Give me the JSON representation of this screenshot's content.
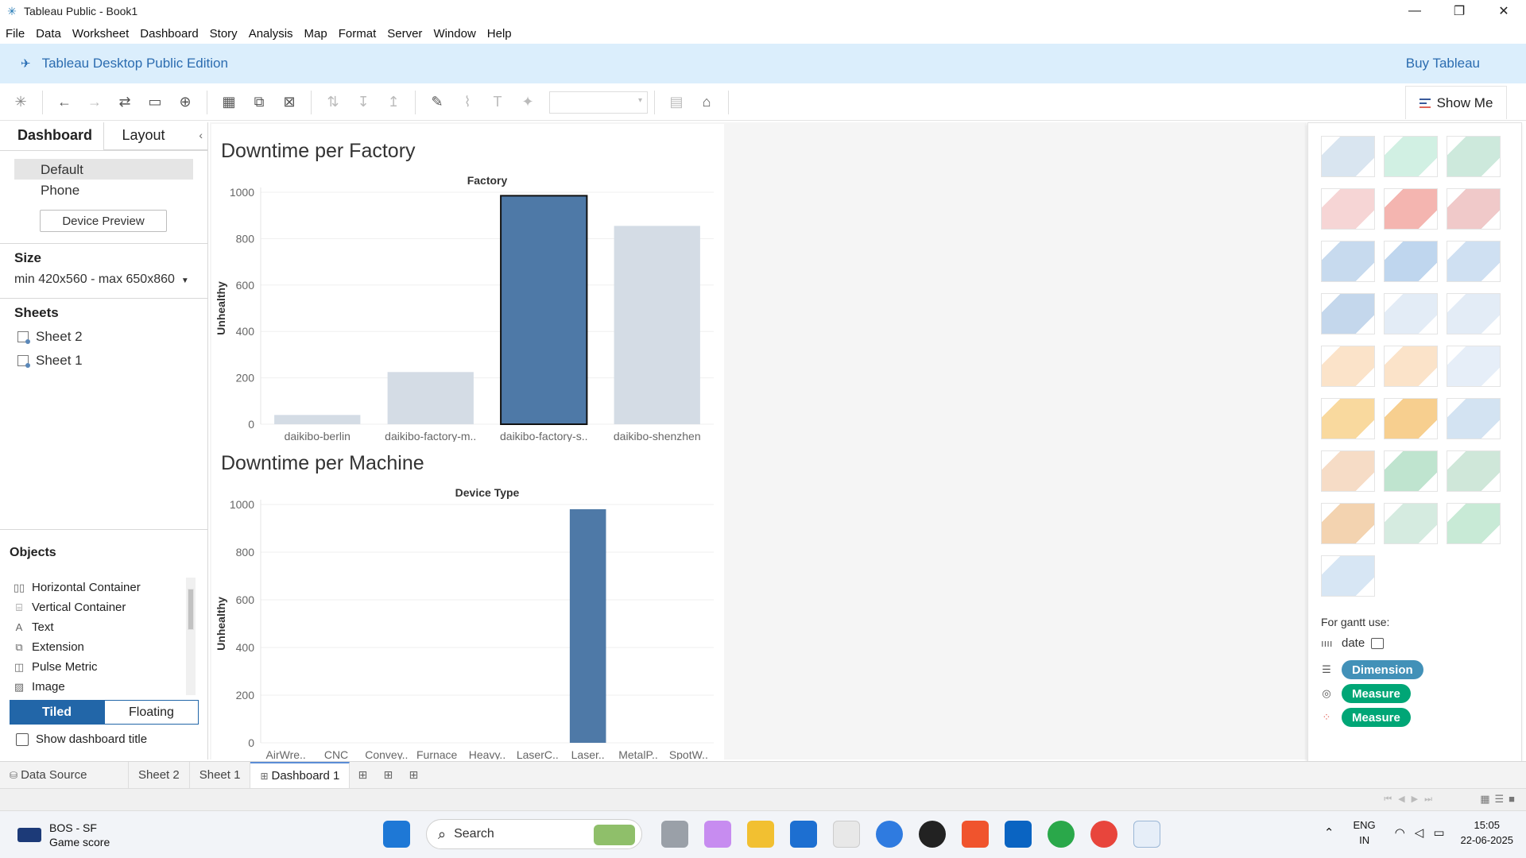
{
  "window": {
    "title": "Tableau Public - Book1",
    "controls": [
      "—",
      "❐",
      "✕"
    ]
  },
  "menu": [
    "File",
    "Data",
    "Worksheet",
    "Dashboard",
    "Story",
    "Analysis",
    "Map",
    "Format",
    "Server",
    "Window",
    "Help"
  ],
  "banner": {
    "edition": "Tableau Desktop Public Edition",
    "buy": "Buy Tableau"
  },
  "toolbar": {
    "show_me": "Show Me"
  },
  "left_panel": {
    "tabs": [
      "Dashboard",
      "Layout"
    ],
    "devices": [
      "Default",
      "Phone"
    ],
    "device_preview": "Device Preview",
    "size_heading": "Size",
    "size_value": "min 420x560 - max 650x860",
    "sheets_heading": "Sheets",
    "sheets": [
      "Sheet 2",
      "Sheet 1"
    ],
    "objects_heading": "Objects",
    "objects": [
      "Horizontal Container",
      "Vertical Container",
      "Text",
      "Extension",
      "Pulse Metric",
      "Image"
    ],
    "tiled": "Tiled",
    "floating": "Floating",
    "show_title": "Show dashboard title"
  },
  "chart_data": [
    {
      "type": "bar",
      "title": "Downtime per Factory",
      "xlabel": "Factory",
      "ylabel": "Unhealthy",
      "categories": [
        "daikibo-berlin",
        "daikibo-factory-m..",
        "daikibo-factory-s..",
        "daikibo-shenzhen"
      ],
      "values": [
        40,
        225,
        985,
        855
      ],
      "highlighted": "daikibo-factory-s..",
      "ylim": [
        0,
        1000
      ],
      "yticks": [
        0,
        200,
        400,
        600,
        800,
        1000
      ],
      "colors": {
        "highlight": "#4e79a7",
        "other": "#d4dce5"
      }
    },
    {
      "type": "bar",
      "title": "Downtime per Machine",
      "xlabel": "Device Type",
      "ylabel": "Unhealthy",
      "categories": [
        "AirWre..",
        "CNC",
        "Convey..",
        "Furnace",
        "Heavy..",
        "LaserC..",
        "Laser..",
        "MetalP..",
        "SpotW.."
      ],
      "values": [
        0,
        0,
        0,
        0,
        0,
        0,
        980,
        0,
        0
      ],
      "ylim": [
        0,
        1000
      ],
      "yticks": [
        0,
        200,
        400,
        600,
        800,
        1000
      ],
      "colors": {
        "bar": "#4e79a7"
      }
    }
  ],
  "show_me": {
    "hint": "For gantt use:",
    "rows": [
      {
        "icon": "bars-icon",
        "label": "date"
      },
      {
        "icon": "list-icon",
        "label": "Dimension"
      },
      {
        "icon": "size-icon",
        "label": "Measure"
      },
      {
        "icon": "color-icon",
        "label": "Measure"
      }
    ]
  },
  "sheet_tabs": [
    "Data Source",
    "Sheet 2",
    "Sheet 1",
    "Dashboard 1"
  ],
  "taskbar": {
    "widget_title": "BOS - SF",
    "widget_sub": "Game score",
    "search": "Search",
    "lang1": "ENG",
    "lang2": "IN",
    "time": "15:05",
    "date": "22-06-2025"
  }
}
